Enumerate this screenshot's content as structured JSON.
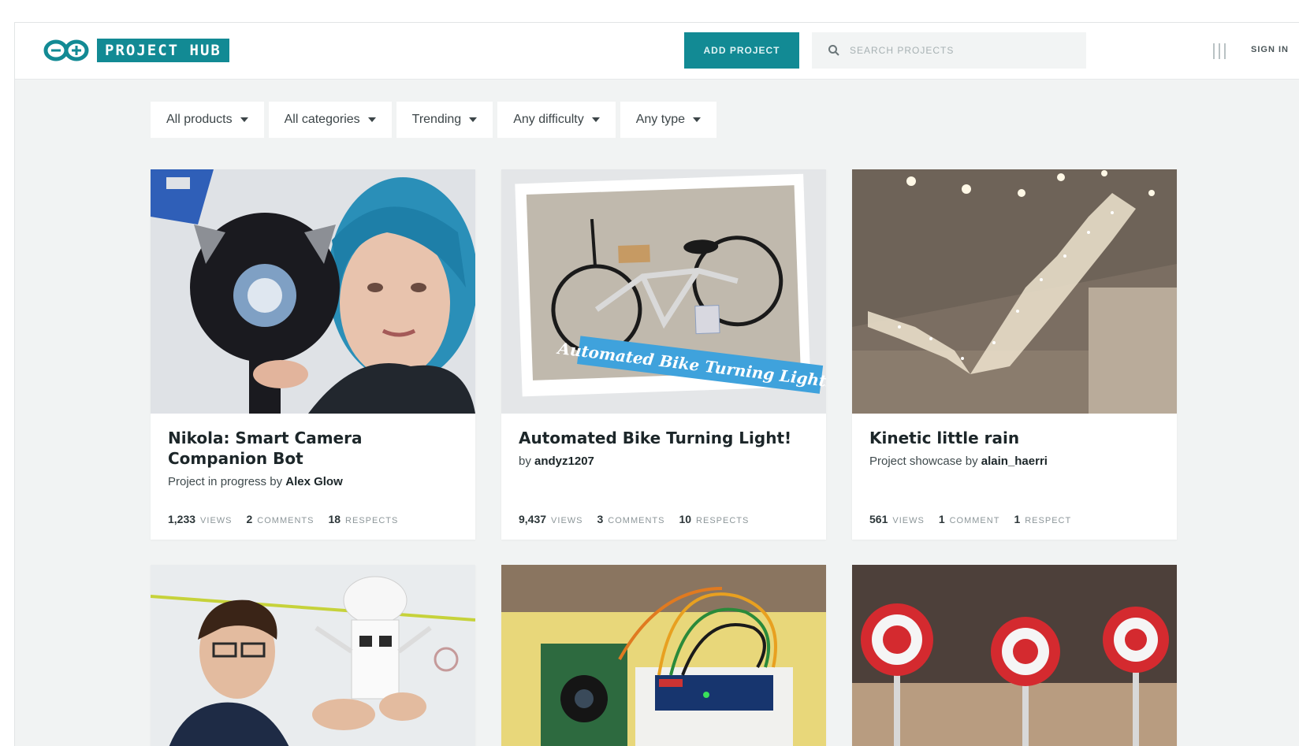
{
  "header": {
    "logo_text": "PROJECT HUB",
    "add_project_label": "ADD PROJECT",
    "search_placeholder": "SEARCH PROJECTS",
    "sign_in_label": "SIGN IN"
  },
  "filters": [
    {
      "label": "All products"
    },
    {
      "label": "All categories"
    },
    {
      "label": "Trending"
    },
    {
      "label": "Any difficulty"
    },
    {
      "label": "Any type"
    }
  ],
  "cards": [
    {
      "title": "Nikola: Smart Camera Companion Bot",
      "byline_prefix": "Project in progress by",
      "author": "Alex Glow",
      "views": "1,233",
      "views_label": "VIEWS",
      "comments": "2",
      "comments_label": "COMMENTS",
      "respects": "18",
      "respects_label": "RESPECTS"
    },
    {
      "title": "Automated Bike Turning Light!",
      "byline_prefix": "by",
      "author": "andyz1207",
      "image_caption": "Automated Bike Turning Lights!",
      "views": "9,437",
      "views_label": "VIEWS",
      "comments": "3",
      "comments_label": "COMMENTS",
      "respects": "10",
      "respects_label": "RESPECTS"
    },
    {
      "title": "Kinetic little rain",
      "byline_prefix": "Project showcase by",
      "author": "alain_haerri",
      "views": "561",
      "views_label": "VIEWS",
      "comments": "1",
      "comments_label": "COMMENT",
      "respects": "1",
      "respects_label": "RESPECT"
    }
  ],
  "colors": {
    "brand_teal": "#128a94",
    "page_bg": "#f1f3f3",
    "card_bg": "#ffffff"
  }
}
